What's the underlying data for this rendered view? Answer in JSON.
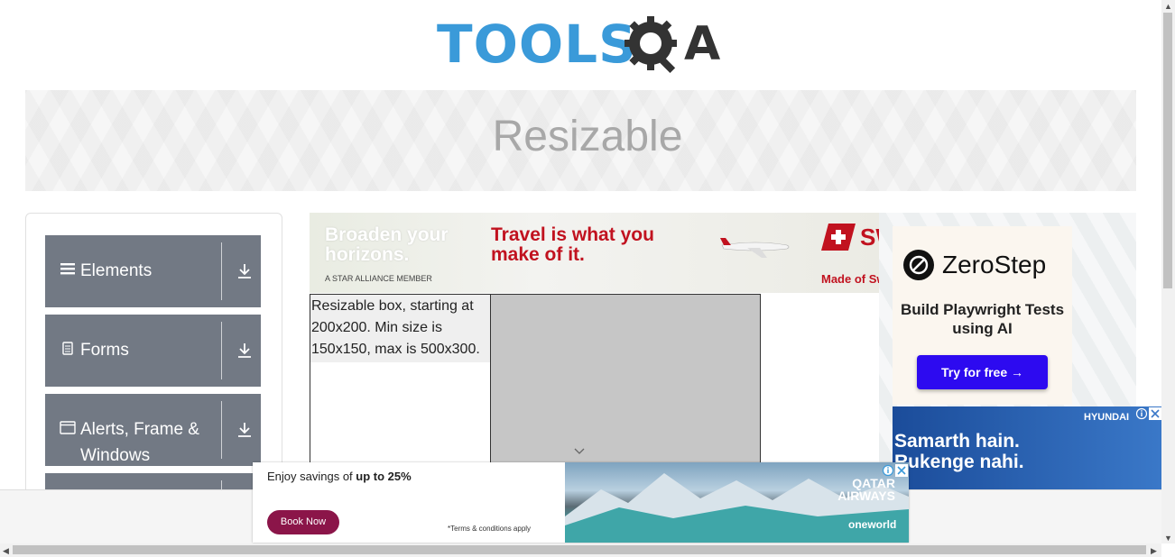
{
  "header": {
    "logo_tools": "TOOLS",
    "logo_a": "A"
  },
  "banner": {
    "title": "Resizable"
  },
  "sidebar": {
    "groups": [
      {
        "label": "Elements",
        "icon": "hamburger-icon"
      },
      {
        "label": "Forms",
        "icon": "document-icon"
      },
      {
        "label": "Alerts, Frame & Windows",
        "icon": "window-icon"
      }
    ]
  },
  "ads": {
    "top": {
      "left_text": "Broaden your horizons.",
      "member": "A STAR ALLIANCE MEMBER",
      "headline": "Travel is what you make of it.",
      "brand": "SW",
      "tagline": "Made of Sw"
    },
    "zerostep": {
      "name": "ZeroStep",
      "subtitle": "Build Playwright Tests using AI",
      "button": "Try for free →"
    },
    "hyundai": {
      "brand": "HYUNDAI",
      "text": "Samarth hain. Rukenge nahi."
    },
    "qatar": {
      "text_prefix": "Enjoy savings of ",
      "text_bold": "up to 25%",
      "button": "Book Now",
      "terms": "*Terms & conditions apply",
      "brand": "QATAR AIRWAYS",
      "alliance": "oneworld"
    }
  },
  "resizable": {
    "text": "Resizable box, starting at 200x200. Min size is 150x150, max is 500x300."
  },
  "colors": {
    "accent_blue": "#3a9ad9",
    "sidebar_group": "#727984",
    "zerostep_button": "#2d0af0",
    "qatar_button": "#8b1549"
  }
}
